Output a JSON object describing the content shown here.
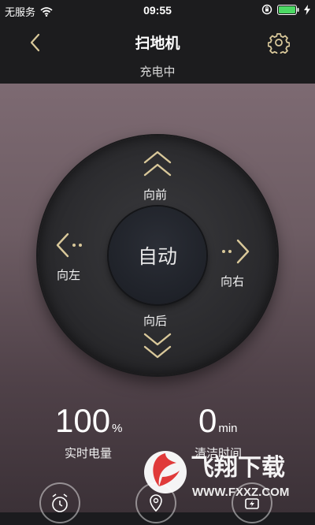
{
  "status_bar": {
    "carrier": "无服务",
    "time": "09:55"
  },
  "nav": {
    "title": "扫地机",
    "subtitle": "充电中"
  },
  "controls": {
    "center_label": "自动",
    "forward_label": "向前",
    "left_label": "向左",
    "right_label": "向右",
    "back_label": "向后"
  },
  "stats": {
    "battery_value": "100",
    "battery_unit": "%",
    "battery_label": "实时电量",
    "clean_value": "0",
    "clean_unit": "min",
    "clean_label": "清洁时间"
  },
  "watermark": {
    "brand": "飞翔下载",
    "url": "WWW.FXXZ.COM"
  },
  "colors": {
    "accent_gold": "#d9c89a",
    "battery_green": "#4cd964"
  },
  "icons": [
    "wifi-icon",
    "lock-rotation-icon",
    "battery-icon",
    "charging-icon",
    "back-icon",
    "gear-icon",
    "up-chevron-icon",
    "down-chevron-icon",
    "left-arrow-icon",
    "right-arrow-icon",
    "alarm-clock-icon",
    "location-icon",
    "charge-dock-icon"
  ]
}
